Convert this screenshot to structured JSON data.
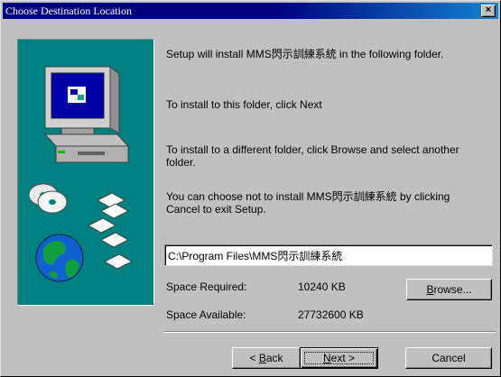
{
  "window": {
    "title": "Choose Destination Location",
    "close_glyph": "×"
  },
  "content": {
    "intro": "Setup will install MMS閃示訓練系統 in the following folder.",
    "next_hint": "To install to this folder, click Next",
    "browse_hint": "To install to a different folder, click Browse and select another folder.",
    "cancel_hint": "You can choose not to install MMS閃示訓練系統 by clicking Cancel to exit Setup."
  },
  "destination": {
    "path": "C:\\Program Files\\MMS閃示訓練系統"
  },
  "space": {
    "required_label": "Space Required:",
    "required_value": "10240 KB",
    "available_label": "Space Available:",
    "available_value": "27732600 KB"
  },
  "buttons": {
    "browse_mnemonic": "B",
    "browse_rest": "rowse...",
    "back_prefix": "< ",
    "back_mnemonic": "B",
    "back_rest": "ack",
    "next_mnemonic": "N",
    "next_rest": "ext >",
    "cancel": "Cancel"
  },
  "illustration": {
    "icons": [
      "computer-icon",
      "cd-discs-icon",
      "floppy-disks-icon",
      "globe-icon"
    ],
    "colors": {
      "background": "#008080",
      "screen": "#0000a8",
      "globe_sea": "#1060d0",
      "globe_land": "#10a040"
    }
  }
}
